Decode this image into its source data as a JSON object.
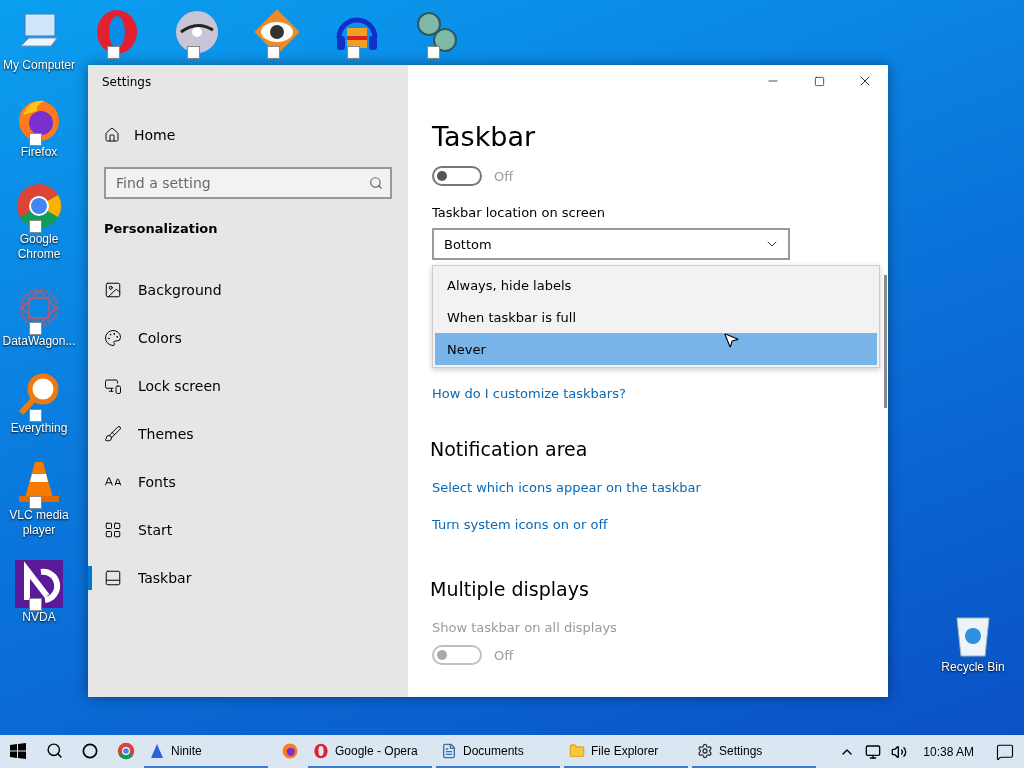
{
  "desktop": {
    "top_row": [
      {
        "kind": "computer",
        "label": "My Computer"
      },
      {
        "kind": "opera"
      },
      {
        "kind": "disc"
      },
      {
        "kind": "eye"
      },
      {
        "kind": "headphones"
      },
      {
        "kind": "lenses"
      }
    ],
    "left_column": [
      {
        "kind": "firefox",
        "label": "Firefox"
      },
      {
        "kind": "chrome",
        "label": "Google Chrome"
      },
      {
        "kind": "mesh",
        "label": "DataWagon..."
      },
      {
        "kind": "magnifier",
        "label": "Everything"
      },
      {
        "kind": "cone",
        "label": "VLC media player"
      },
      {
        "kind": "nvda",
        "label": "NVDA"
      }
    ],
    "right_column": [
      {
        "kind": "recycle",
        "label": "Recycle Bin"
      }
    ]
  },
  "window": {
    "title": "Settings",
    "sidebar": {
      "home": "Home",
      "search": {
        "placeholder": "Find a setting"
      },
      "section": "Personalization",
      "items": [
        {
          "kind": "background",
          "label": "Background",
          "selected": false
        },
        {
          "kind": "colors",
          "label": "Colors",
          "selected": false
        },
        {
          "kind": "lock",
          "label": "Lock screen",
          "selected": false
        },
        {
          "kind": "themes",
          "label": "Themes",
          "selected": false
        },
        {
          "kind": "fonts",
          "label": "Fonts",
          "selected": false
        },
        {
          "kind": "start",
          "label": "Start",
          "selected": false
        },
        {
          "kind": "taskbar",
          "label": "Taskbar",
          "selected": true
        }
      ]
    },
    "content": {
      "title": "Taskbar",
      "toggle": {
        "on": false,
        "label": "Off"
      },
      "location": {
        "label": "Taskbar location on screen",
        "value": "Bottom"
      },
      "dropdown": {
        "options": [
          {
            "label": "Always, hide labels",
            "selected": false
          },
          {
            "label": "When taskbar is full",
            "selected": false
          },
          {
            "label": "Never",
            "selected": true
          }
        ]
      },
      "help_link": "How do I customize taskbars?",
      "notification_area": {
        "heading": "Notification area",
        "links": [
          "Select which icons appear on the taskbar",
          "Turn system icons on or off"
        ]
      },
      "multiple_displays": {
        "heading": "Multiple displays",
        "setting": {
          "label": "Show taskbar on all displays",
          "disabled": true,
          "on": false,
          "state": "Off"
        }
      }
    }
  },
  "taskbar": {
    "items": [
      {
        "kind": "chrome",
        "running": false
      },
      {
        "kind": "ninite",
        "label": "Ninite",
        "running": true
      },
      {
        "kind": "firefox",
        "running": false
      },
      {
        "kind": "opera",
        "label": "Google - Opera",
        "running": true
      },
      {
        "kind": "documents",
        "label": "Documents",
        "running": true
      },
      {
        "kind": "explorer",
        "label": "File Explorer",
        "running": true
      },
      {
        "kind": "settings",
        "label": "Settings",
        "running": true
      }
    ],
    "clock": "10:38 AM"
  }
}
